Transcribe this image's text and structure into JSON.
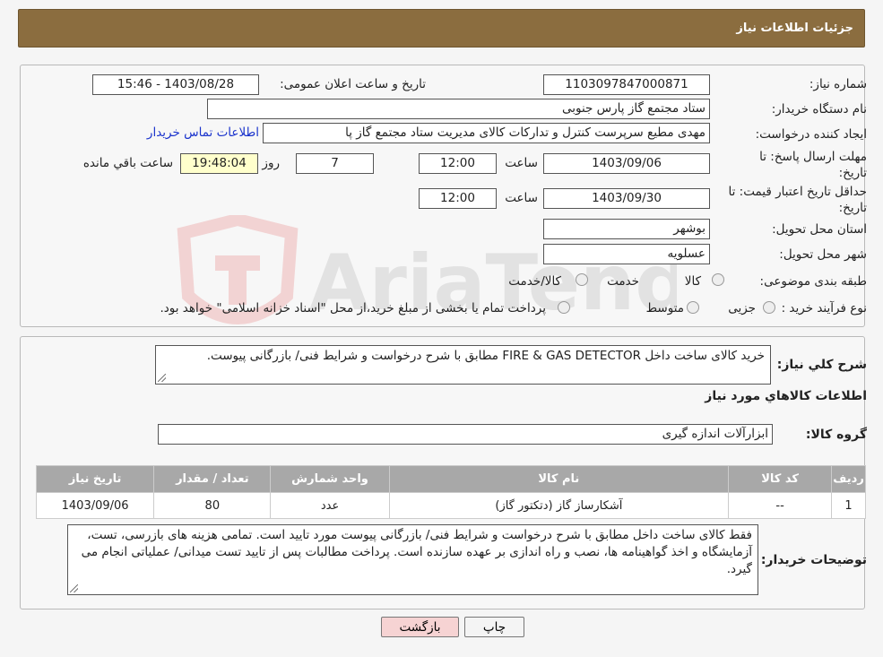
{
  "header": {
    "title": "جزئیات اطلاعات نیاز"
  },
  "form": {
    "need_number_label": "شماره نیاز:",
    "need_number": "1103097847000871",
    "announce_label": "تاریخ و ساعت اعلان عمومی:",
    "announce_value": "1403/08/28 - 15:46",
    "buyer_org_label": "نام دستگاه خریدار:",
    "buyer_org": "ستاد مجتمع گاز پارس جنوبی",
    "creator_label": "ایجاد کننده درخواست:",
    "creator": "مهدی مطیع سرپرست کنترل و تدارکات کالای مدیریت ستاد مجتمع گاز پا",
    "contact_link": "اطلاعات تماس خریدار",
    "deadline_label_1": "مهلت ارسال پاسخ: تا",
    "deadline_label_2": "تاریخ:",
    "deadline_date": "1403/09/06",
    "time_label": "ساعت",
    "deadline_time": "12:00",
    "days_value": "7",
    "days_label": "روز و",
    "remaining_time": "19:48:04",
    "remaining_label": "ساعت باقي مانده",
    "validity_label_1": "حداقل تاریخ اعتبار قیمت: تا",
    "validity_label_2": "تاریخ:",
    "validity_date": "1403/09/30",
    "validity_time": "12:00",
    "province_label": "استان محل تحویل:",
    "province": "بوشهر",
    "city_label": "شهر محل تحویل:",
    "city": "عسلویه",
    "category_label": "طبقه بندی موضوعی:",
    "category_options": [
      "کالا",
      "خدمت",
      "کالا/خدمت"
    ],
    "process_label": "نوع فرآیند خرید :",
    "process_options": [
      "جزیی",
      "متوسط"
    ],
    "process_note": "پرداخت تمام یا بخشی از مبلغ خرید،از محل \"اسناد خزانه اسلامی\" خواهد بود."
  },
  "summary": {
    "label": "شرح کلي نياز:",
    "text": "خرید کالای ساخت داخل     FIRE & GAS DETECTOR مطابق با شرح درخواست و شرایط فنی/ بازرگانی پیوست.",
    "goods_info_title": "اطلاعات کالاهاي مورد نياز",
    "goods_group_label": "گروه کالا:",
    "goods_group": "ابزارآلات اندازه گیری"
  },
  "table": {
    "headers": [
      "ردیف",
      "کد کالا",
      "نام کالا",
      "واحد شمارش",
      "تعداد / مقدار",
      "تاریخ نیاز"
    ],
    "rows": [
      [
        "1",
        "--",
        "آشکارساز گاز (دتکتور گاز)",
        "عدد",
        "80",
        "1403/09/06"
      ]
    ]
  },
  "buyer_notes": {
    "label": "توضیحات خریدار:",
    "text": "فقط کالای ساخت داخل مطابق با شرح درخواست و شرایط فنی/ بازرگانی پیوست مورد تایید است. تمامی هزینه های بازرسی، تست، آزمایشگاه و اخذ گواهینامه ها، نصب و راه اندازی بر عهده سازنده است. پرداخت مطالبات پس از تایید تست میدانی/ عملیاتی انجام می گیرد."
  },
  "buttons": {
    "back": "بازگشت",
    "print": "چاپ"
  },
  "watermark": {
    "text": "AriaTender.neT"
  },
  "colors": {
    "header": "#8b6d3f",
    "back_button": "#f6d3d3",
    "link": "#1a33cc"
  }
}
